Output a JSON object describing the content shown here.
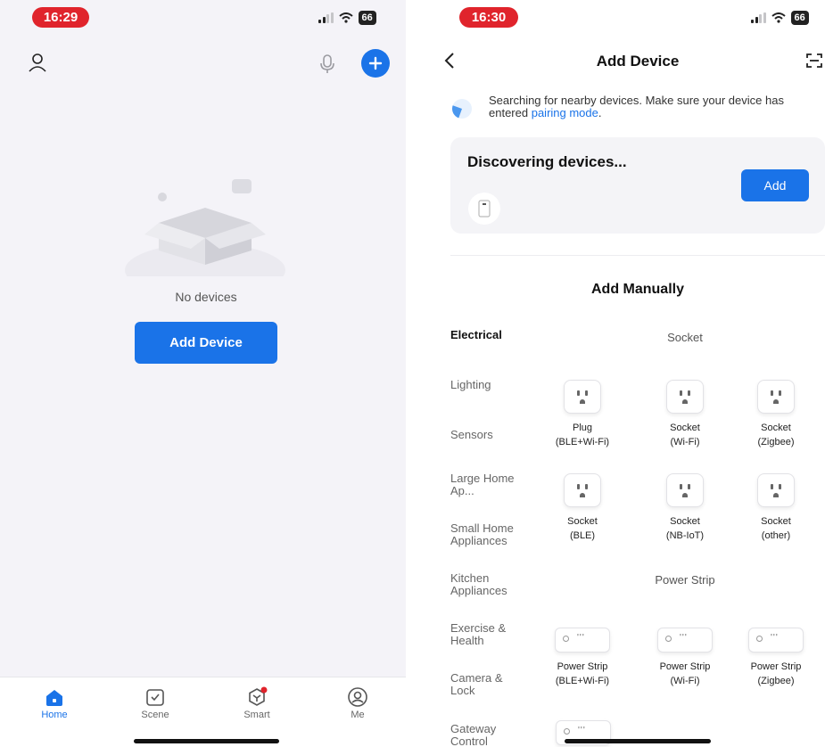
{
  "left": {
    "status": {
      "time": "16:29",
      "battery": "66"
    },
    "empty_text": "No devices",
    "add_button": "Add Device",
    "tabs": [
      {
        "label": "Home",
        "icon": "home-icon"
      },
      {
        "label": "Scene",
        "icon": "scene-icon"
      },
      {
        "label": "Smart",
        "icon": "smart-icon"
      },
      {
        "label": "Me",
        "icon": "me-icon"
      }
    ]
  },
  "right": {
    "status": {
      "time": "16:30",
      "battery": "66"
    },
    "title": "Add Device",
    "search": {
      "text": "Searching for nearby devices. Make sure your device has entered",
      "link": "pairing mode",
      "suffix": "."
    },
    "discover": {
      "title": "Discovering devices...",
      "add_button": "Add"
    },
    "manual_title": "Add Manually",
    "categories": [
      "Electrical",
      "Lighting",
      "Sensors",
      "Large Home Ap...",
      "Small Home Appliances",
      "Kitchen Appliances",
      "Exercise & Health",
      "Camera & Lock",
      "Gateway Control"
    ],
    "sections": [
      {
        "title": "Socket",
        "items": [
          {
            "line1": "Plug",
            "line2": "(BLE+Wi-Fi)"
          },
          {
            "line1": "Socket",
            "line2": "(Wi-Fi)"
          },
          {
            "line1": "Socket",
            "line2": "(Zigbee)"
          },
          {
            "line1": "Socket",
            "line2": "(BLE)"
          },
          {
            "line1": "Socket",
            "line2": "(NB-IoT)"
          },
          {
            "line1": "Socket",
            "line2": "(other)"
          }
        ]
      },
      {
        "title": "Power Strip",
        "items": [
          {
            "line1": "Power Strip",
            "line2": "(BLE+Wi-Fi)"
          },
          {
            "line1": "Power Strip",
            "line2": "(Wi-Fi)"
          },
          {
            "line1": "Power Strip",
            "line2": "(Zigbee)"
          }
        ]
      }
    ]
  },
  "colors": {
    "accent": "#1a73e8",
    "status_pill": "#e0242c",
    "left_bg": "#f4f3f8",
    "badge": "#e0242c"
  }
}
